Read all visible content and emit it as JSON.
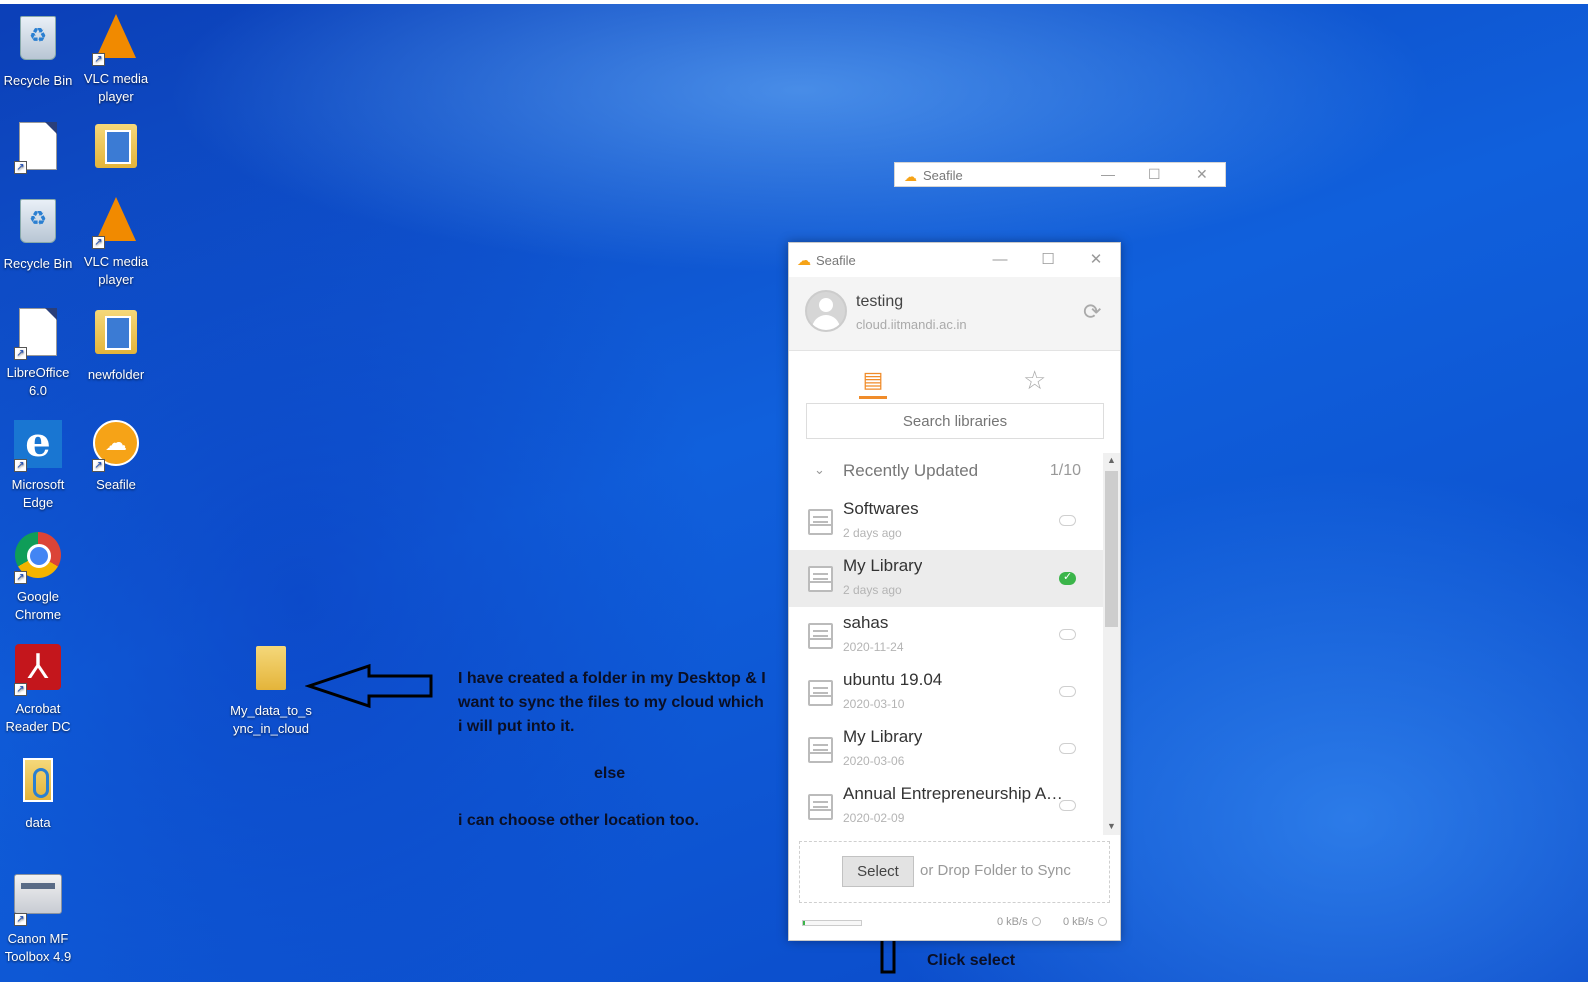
{
  "desktop": {
    "icons": [
      {
        "label": "Recycle Bin"
      },
      {
        "label": "VLC media player"
      },
      {
        "label": "Recycle Bin"
      },
      {
        "label": "VLC media player"
      },
      {
        "label": "LibreOffice 6.0"
      },
      {
        "label": "newfolder"
      },
      {
        "label": "Microsoft Edge"
      },
      {
        "label": "Seafile"
      },
      {
        "label": "Google Chrome"
      },
      {
        "label": "Acrobat Reader DC"
      },
      {
        "label": "data"
      },
      {
        "label": "Canon MF Toolbox 4.9"
      },
      {
        "label": "My_data_to_sync_in_cloud"
      }
    ]
  },
  "back_window": {
    "title": "Seafile"
  },
  "window": {
    "title": "Seafile",
    "account": {
      "name": "testing",
      "server": "cloud.iitmandi.ac.in"
    },
    "search_placeholder": "Search libraries",
    "group": {
      "name": "Recently Updated",
      "count": "1/10"
    },
    "libraries": [
      {
        "name": "Softwares",
        "date": "2 days ago",
        "synced": false
      },
      {
        "name": "My Library",
        "date": "2 days ago",
        "synced": true
      },
      {
        "name": "sahas",
        "date": "2020-11-24",
        "synced": false
      },
      {
        "name": "ubuntu 19.04",
        "date": "2020-03-10",
        "synced": false
      },
      {
        "name": "My Library",
        "date": "2020-03-06",
        "synced": false
      },
      {
        "name": "Annual Entrepreneurship Awa...",
        "date": "2020-02-09",
        "synced": false
      }
    ],
    "select_label": "Select",
    "drop_text": "or Drop Folder to Sync",
    "upload_rate": "0 kB/s",
    "download_rate": "0 kB/s"
  },
  "annotations": {
    "line1": "I have created a folder in my Desktop & I",
    "line2": "want to sync the files to my cloud which",
    "line3": "i will put into it.",
    "else": "else",
    "other": "i can choose other location too.",
    "click": "Click select"
  },
  "colors": {
    "accent": "#f08c2a",
    "synced": "#3bb54a",
    "desktop": "#0a49c8"
  }
}
